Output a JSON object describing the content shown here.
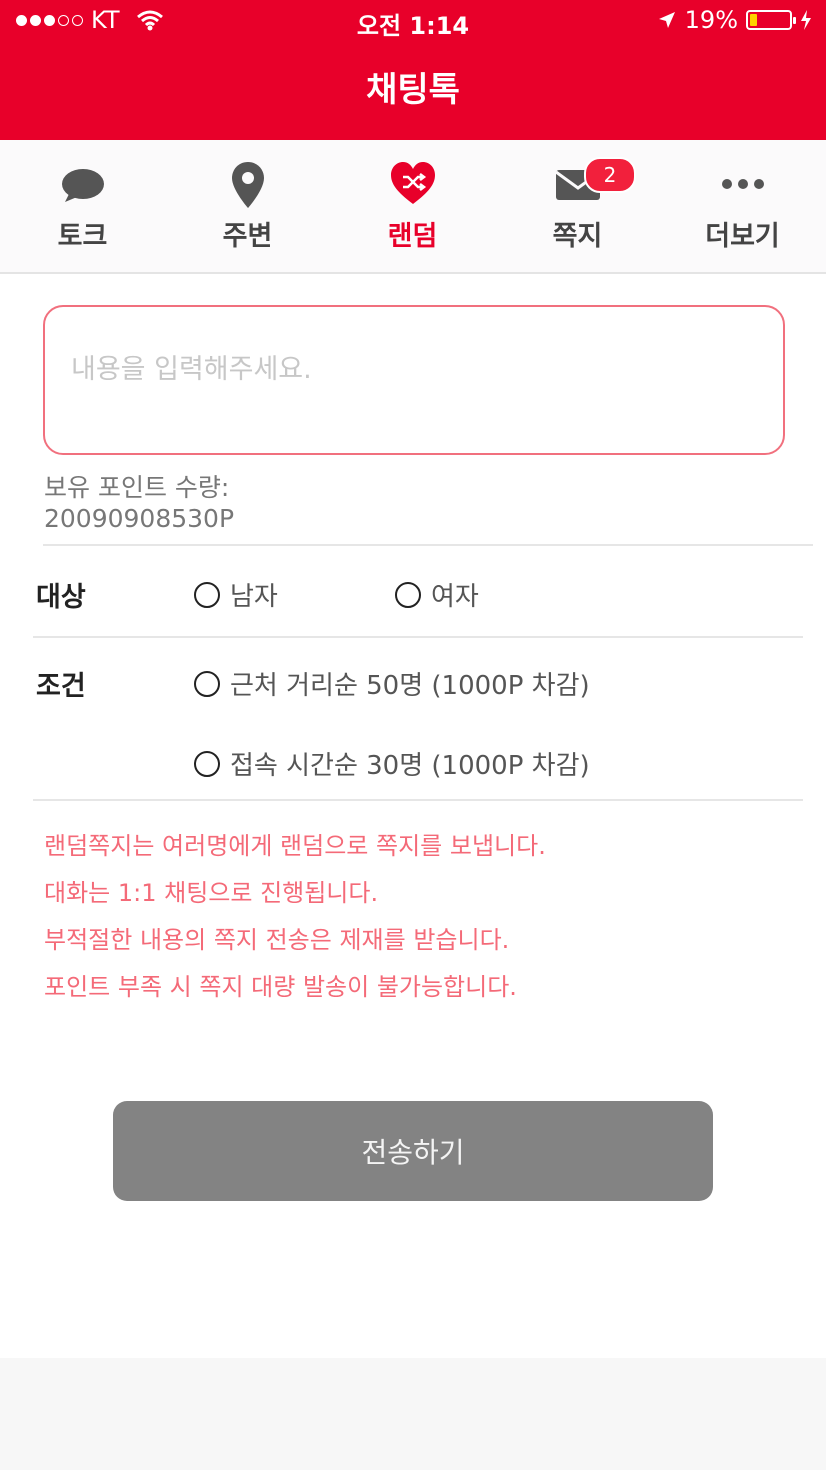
{
  "status_bar": {
    "carrier": "KT",
    "time": "오전 1:14",
    "battery": "19%",
    "battery_level": 0.19
  },
  "header": {
    "title": "채팅톡"
  },
  "tabs": [
    {
      "label": "토크",
      "icon": "speech-bubble-icon"
    },
    {
      "label": "주변",
      "icon": "location-pin-icon"
    },
    {
      "label": "랜덤",
      "icon": "heart-shuffle-icon",
      "active": true
    },
    {
      "label": "쪽지",
      "icon": "envelope-icon",
      "badge": "2"
    },
    {
      "label": "더보기",
      "icon": "more-dots-icon"
    }
  ],
  "message": {
    "placeholder": "내용을 입력해주세요."
  },
  "points": {
    "label": "보유 포인트 수량:",
    "value": "20090908530P"
  },
  "target": {
    "label": "대상",
    "options": [
      "남자",
      "여자"
    ]
  },
  "condition": {
    "label": "조건",
    "options": [
      "근처 거리순 50명 (1000P 차감)",
      "접속 시간순 30명 (1000P 차감)"
    ]
  },
  "notices": [
    "랜덤쪽지는 여러명에게 랜덤으로 쪽지를 보냅니다.",
    "대화는 1:1 채팅으로 진행됩니다.",
    "부적절한 내용의 쪽지 전송은 제재를 받습니다.",
    "포인트 부족 시 쪽지 대량 발송이 불가능합니다."
  ],
  "send_button": {
    "label": "전송하기"
  },
  "colors": {
    "brand": "#e8002a",
    "notice": "#f46a78",
    "button": "#838383"
  }
}
